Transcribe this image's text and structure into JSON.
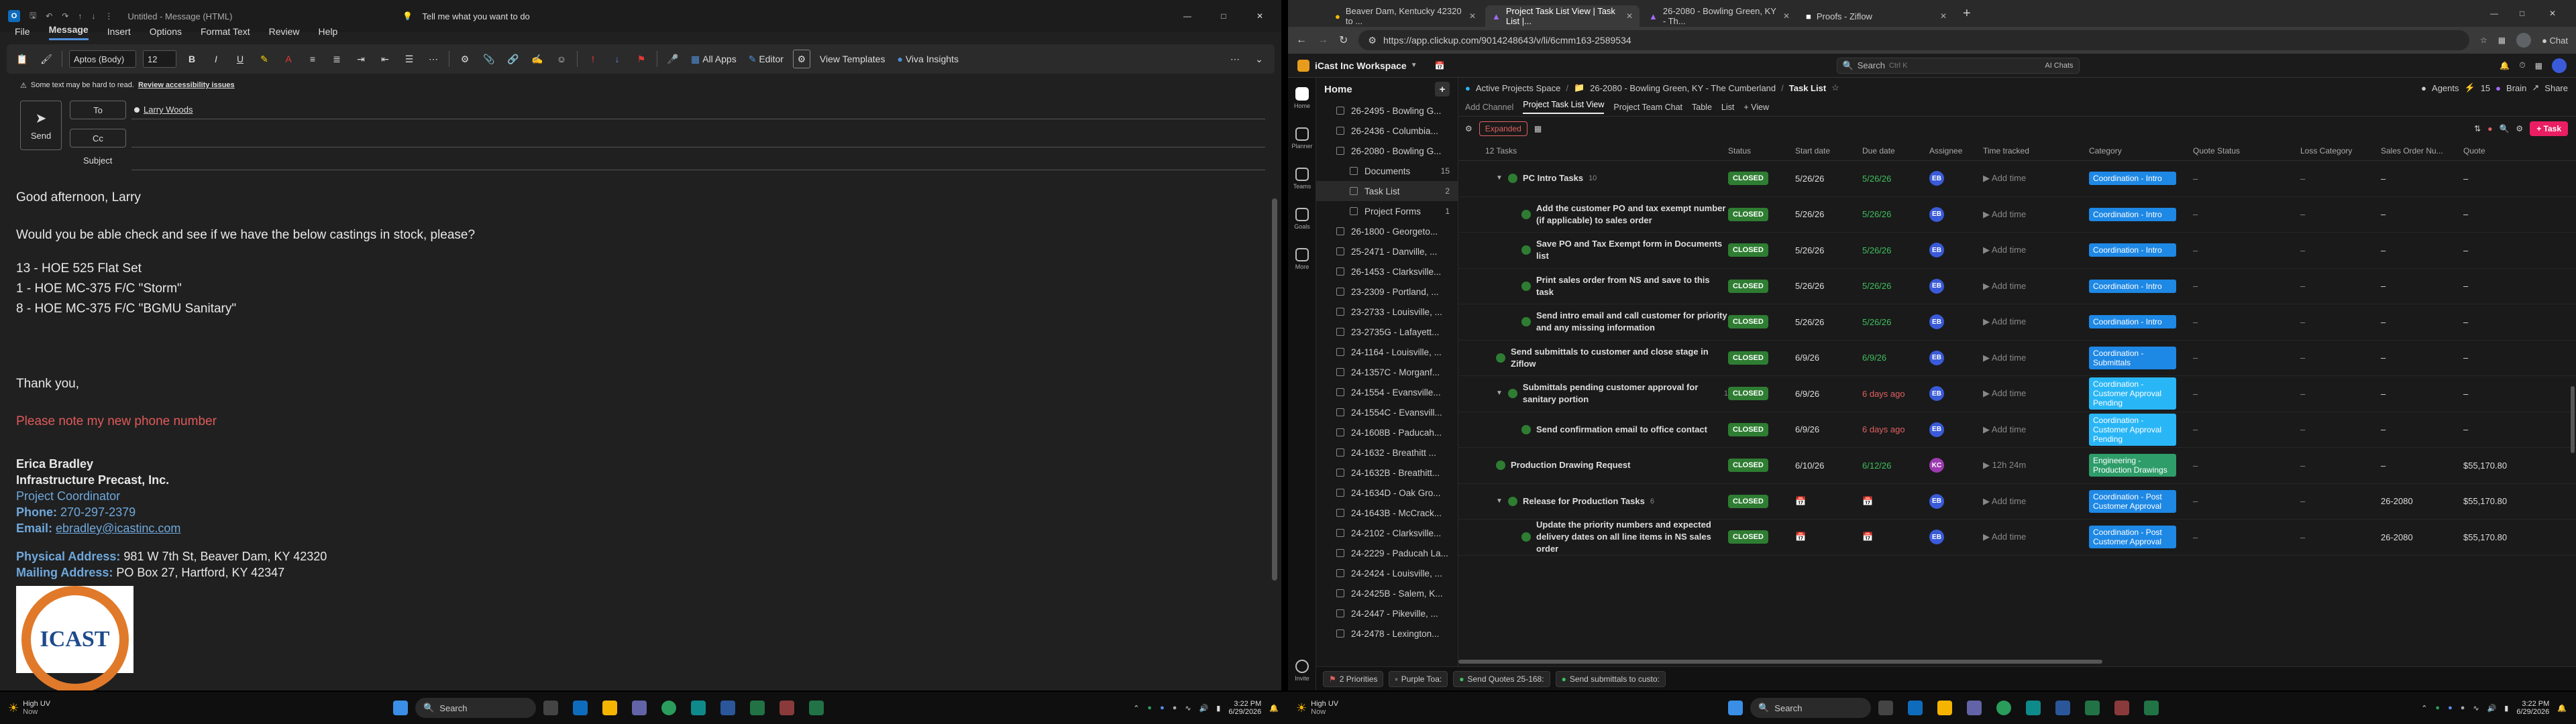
{
  "outlook": {
    "title": "Untitled - Message (HTML)",
    "search_placeholder": "Tell me what you want to do",
    "menu": [
      "File",
      "Message",
      "Insert",
      "Options",
      "Format Text",
      "Review",
      "Help"
    ],
    "ribbon": {
      "font": "Aptos (Body)",
      "size": "12",
      "all_apps": "All Apps",
      "editor": "Editor",
      "view_templates": "View Templates",
      "viva_insights": "Viva Insights"
    },
    "accessibility_notice": "Some text may be hard to read.",
    "accessibility_link": "Review accessibility issues",
    "send_label": "Send",
    "to_label": "To",
    "cc_label": "Cc",
    "subject_label": "Subject",
    "to_value": "Larry Woods",
    "body": {
      "greeting": "Good afternoon, Larry",
      "question": "Would you be able check and see if we have the below castings in stock, please?",
      "line1": "13 - HOE 525 Flat Set",
      "line2": "1 - HOE MC-375 F/C \"Storm\"",
      "line3": "8 - HOE MC-375 F/C \"BGMU Sanitary\"",
      "thanks": "Thank you,",
      "phone_note": "Please note my new phone number",
      "sig_name": "Erica Bradley",
      "sig_company": "Infrastructure Precast, Inc.",
      "sig_title": "Project Coordinator",
      "phone_label": "Phone:",
      "phone": "270-297-2379",
      "email_label": "Email:",
      "email": "ebradley@icastinc.com",
      "phys_label": "Physical Address:",
      "phys_addr": "981 W 7th St, Beaver Dam, KY 42320",
      "mail_label": "Mailing Address:",
      "mail_addr": "PO Box 27, Hartford, KY 42347",
      "logo_text": "ICAST"
    }
  },
  "chrome": {
    "tabs": [
      {
        "title": "Beaver Dam, Kentucky 42320 to ..."
      },
      {
        "title": "Project Task List View | Task List |..."
      },
      {
        "title": "26-2080 - Bowling Green, KY - Th..."
      },
      {
        "title": "Proofs - Ziflow"
      }
    ],
    "url": "https://app.clickup.com/9014248643/v/li/6cmm163-2589534",
    "clickup": {
      "workspace": "iCast Inc Workspace",
      "search_placeholder": "Search",
      "search_shortcut": "Ctrl K",
      "ai_label": "AI Chats",
      "home_label": "Home",
      "rail": [
        "Home",
        "Planner",
        "Teams",
        "Goals",
        "More",
        "Invite"
      ],
      "breadcrumb": [
        "Active Projects Space",
        "26-2080 - Bowling Green, KY - The Cumberland",
        "Task List"
      ],
      "top_right": {
        "agents": "Agents",
        "count": "15",
        "brain": "Brain",
        "share": "Share"
      },
      "views": [
        "Add Channel",
        "Project Task List View",
        "Project Team Chat",
        "Table",
        "List",
        "View"
      ],
      "filter_expanded": "Expanded",
      "task_button": "Task",
      "task_count": "12 Tasks",
      "columns": [
        "Status",
        "Start date",
        "Due date",
        "Assignee",
        "Time tracked",
        "Category",
        "Quote Status",
        "Loss Category",
        "Sales Order Nu...",
        "Quote"
      ],
      "sidebar": [
        {
          "label": "26-2495 - Bowling G...",
          "sub": false
        },
        {
          "label": "26-2436 - Columbia...",
          "sub": false
        },
        {
          "label": "26-2080 - Bowling G...",
          "sub": false
        },
        {
          "label": "Documents",
          "sub": true,
          "count": "15"
        },
        {
          "label": "Task List",
          "sub": true,
          "count": "2",
          "sel": true
        },
        {
          "label": "Project Forms",
          "sub": true,
          "count": "1"
        },
        {
          "label": "26-1800 - Georgeto...",
          "sub": false
        },
        {
          "label": "25-2471 - Danville, ...",
          "sub": false
        },
        {
          "label": "26-1453 - Clarksville...",
          "sub": false
        },
        {
          "label": "23-2309 - Portland, ...",
          "sub": false
        },
        {
          "label": "23-2733 - Louisville, ...",
          "sub": false
        },
        {
          "label": "23-2735G - Lafayett...",
          "sub": false
        },
        {
          "label": "24-1164 - Louisville, ...",
          "sub": false
        },
        {
          "label": "24-1357C - Morganf...",
          "sub": false
        },
        {
          "label": "24-1554 - Evansville...",
          "sub": false
        },
        {
          "label": "24-1554C - Evansvill...",
          "sub": false
        },
        {
          "label": "24-1608B - Paducah...",
          "sub": false
        },
        {
          "label": "24-1632 - Breathitt ...",
          "sub": false
        },
        {
          "label": "24-1632B - Breathitt...",
          "sub": false
        },
        {
          "label": "24-1634D - Oak Gro...",
          "sub": false
        },
        {
          "label": "24-1643B - McCrack...",
          "sub": false
        },
        {
          "label": "24-2102 - Clarksville...",
          "sub": false
        },
        {
          "label": "24-2229 - Paducah La...",
          "sub": false
        },
        {
          "label": "24-2424 - Louisville, ...",
          "sub": false
        },
        {
          "label": "24-2425B - Salem, K...",
          "sub": false
        },
        {
          "label": "24-2447 - Pikeville, ...",
          "sub": false
        },
        {
          "label": "24-2478 - Lexington...",
          "sub": false
        }
      ],
      "rows": [
        {
          "name": "PC Intro Tasks",
          "sub": false,
          "status": "CLOSED",
          "start": "5/26/26",
          "due": "5/26/26",
          "due_color": "green",
          "assignee": "EB",
          "av_color": "#3a5bd9",
          "time": "Add time",
          "cat": "Coordination - Intro",
          "cat_color": "blue",
          "qs": "–",
          "loss": "–",
          "so": "–",
          "quote": "–",
          "subcount": "10"
        },
        {
          "name": "Add the customer PO and tax exempt number (if applicable) to sales order",
          "sub": true,
          "status": "CLOSED",
          "start": "5/26/26",
          "due": "5/26/26",
          "due_color": "green",
          "assignee": "EB",
          "av_color": "#3a5bd9",
          "time": "Add time",
          "cat": "Coordination - Intro",
          "cat_color": "blue",
          "qs": "–",
          "loss": "–",
          "so": "–",
          "quote": "–"
        },
        {
          "name": "Save PO and Tax Exempt form in Documents list",
          "sub": true,
          "status": "CLOSED",
          "start": "5/26/26",
          "due": "5/26/26",
          "due_color": "green",
          "assignee": "EB",
          "av_color": "#3a5bd9",
          "time": "Add time",
          "cat": "Coordination - Intro",
          "cat_color": "blue",
          "qs": "–",
          "loss": "–",
          "so": "–",
          "quote": "–"
        },
        {
          "name": "Print sales order from NS and save to this task",
          "sub": true,
          "status": "CLOSED",
          "start": "5/26/26",
          "due": "5/26/26",
          "due_color": "green",
          "assignee": "EB",
          "av_color": "#3a5bd9",
          "time": "Add time",
          "cat": "Coordination - Intro",
          "cat_color": "blue",
          "qs": "–",
          "loss": "–",
          "so": "–",
          "quote": "–"
        },
        {
          "name": "Send intro email and call customer for priority and any missing information",
          "sub": true,
          "status": "CLOSED",
          "start": "5/26/26",
          "due": "5/26/26",
          "due_color": "green",
          "assignee": "EB",
          "av_color": "#3a5bd9",
          "time": "Add time",
          "cat": "Coordination - Intro",
          "cat_color": "blue",
          "qs": "–",
          "loss": "–",
          "so": "–",
          "quote": "–"
        },
        {
          "name": "Send submittals to customer and close stage in Ziflow",
          "sub": false,
          "status": "CLOSED",
          "start": "6/9/26",
          "due": "6/9/26",
          "due_color": "green",
          "assignee": "EB",
          "av_color": "#3a5bd9",
          "time": "Add time",
          "cat": "Coordination - Submittals",
          "cat_color": "blue",
          "qs": "–",
          "loss": "–",
          "so": "–",
          "quote": "–"
        },
        {
          "name": "Submittals pending customer approval for sanitary portion",
          "sub": false,
          "status": "CLOSED",
          "start": "6/9/26",
          "due": "6 days ago",
          "due_color": "red",
          "assignee": "EB",
          "av_color": "#3a5bd9",
          "time": "Add time",
          "cat": "Coordination - Customer Approval Pending",
          "cat_color": "cyan",
          "qs": "–",
          "loss": "–",
          "so": "–",
          "quote": "–",
          "subcount": "1"
        },
        {
          "name": "Send confirmation email to office contact",
          "sub": true,
          "status": "CLOSED",
          "start": "6/9/26",
          "due": "6 days ago",
          "due_color": "red",
          "assignee": "EB",
          "av_color": "#3a5bd9",
          "time": "Add time",
          "cat": "Coordination - Customer Approval Pending",
          "cat_color": "cyan",
          "qs": "–",
          "loss": "–",
          "so": "–",
          "quote": "–"
        },
        {
          "name": "Production Drawing Request",
          "sub": false,
          "status": "CLOSED",
          "start": "6/10/26",
          "due": "6/12/26",
          "due_color": "green",
          "assignee": "KC",
          "av_color": "#9c3ab0",
          "time": "12h 24m",
          "cat": "Engineering - Production Drawings",
          "cat_color": "green",
          "qs": "–",
          "loss": "–",
          "so": "–",
          "quote": "$55,170.80"
        },
        {
          "name": "Release for Production Tasks",
          "sub": false,
          "status": "CLOSED",
          "start": "",
          "due": "",
          "due_color": "green",
          "assignee": "EB",
          "av_color": "#3a5bd9",
          "time": "Add time",
          "cat": "Coordination - Post Customer Approval",
          "cat_color": "blue",
          "qs": "–",
          "loss": "–",
          "so": "26-2080",
          "quote": "$55,170.80",
          "subcount": "6"
        },
        {
          "name": "Update the priority numbers and expected delivery dates on all line items in NS sales order",
          "sub": true,
          "status": "CLOSED",
          "start": "",
          "due": "",
          "due_color": "green",
          "assignee": "EB",
          "av_color": "#3a5bd9",
          "time": "Add time",
          "cat": "Coordination - Post Customer Approval",
          "cat_color": "blue",
          "qs": "–",
          "loss": "–",
          "so": "26-2080",
          "quote": "$55,170.80"
        }
      ],
      "bottom_bar": [
        "2 Priorities",
        "Purple Toa:",
        "Send Quotes 25-168:",
        "Send submittals to custo:"
      ]
    }
  },
  "taskbar_left": {
    "weather": "High UV",
    "weather_sub": "Now",
    "search": "Search",
    "time": "3:22 PM",
    "date": "6/29/2026"
  },
  "taskbar_right": {
    "weather": "High UV",
    "weather_sub": "Now",
    "search": "Search",
    "time": "3:22 PM",
    "date": "6/29/2026"
  },
  "colors": {
    "accent": "#4f8fdb",
    "closed": "#2e7d32",
    "cat_blue": "#1e88e5",
    "cat_cyan": "#29b6f6",
    "cat_green": "#2e9d6a",
    "red_text": "#e06060",
    "sig_blue": "#6fa8dc"
  }
}
